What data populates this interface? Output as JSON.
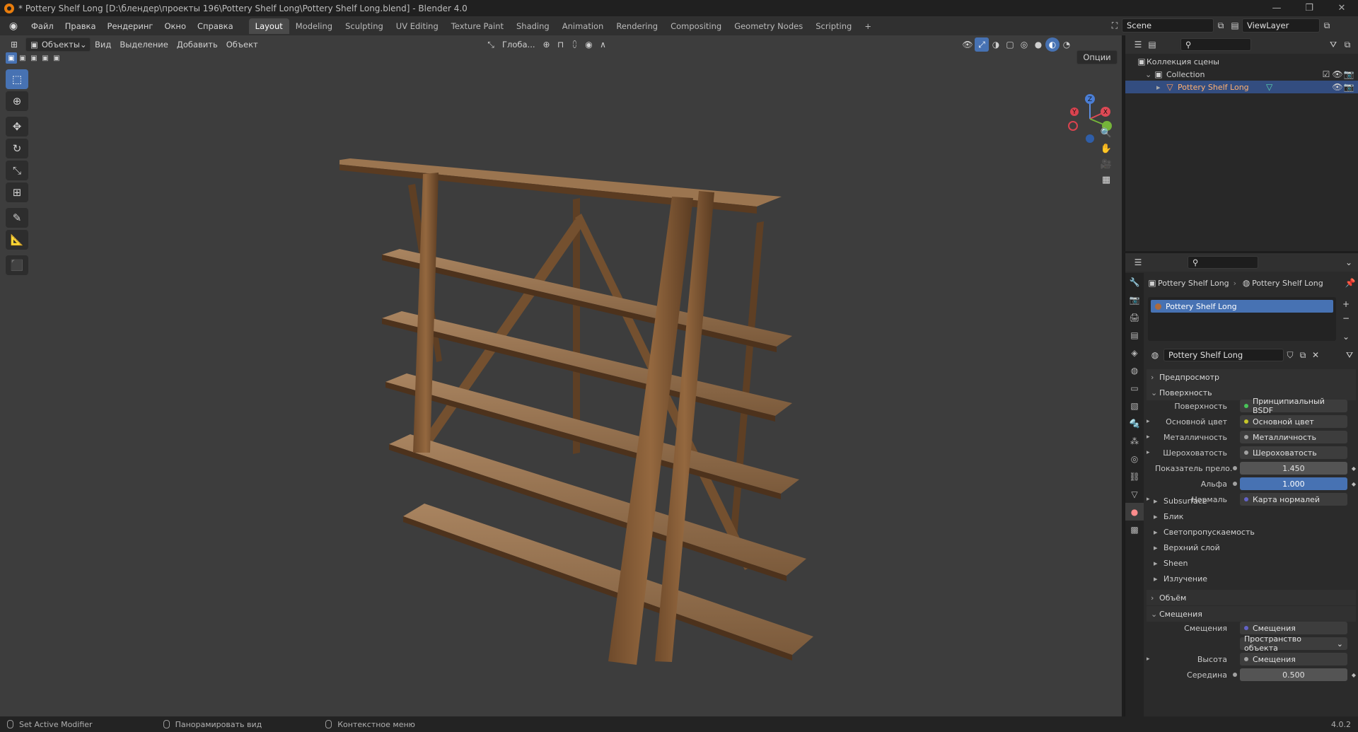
{
  "window": {
    "title": "* Pottery Shelf Long [D:\\блендер\\проекты 196\\Pottery Shelf Long\\Pottery Shelf Long.blend] - Blender 4.0"
  },
  "menu": [
    "Файл",
    "Правка",
    "Рендеринг",
    "Окно",
    "Справка"
  ],
  "workspaces": [
    {
      "label": "Layout",
      "active": true
    },
    {
      "label": "Modeling"
    },
    {
      "label": "Sculpting"
    },
    {
      "label": "UV Editing"
    },
    {
      "label": "Texture Paint"
    },
    {
      "label": "Shading"
    },
    {
      "label": "Animation"
    },
    {
      "label": "Rendering"
    },
    {
      "label": "Compositing"
    },
    {
      "label": "Geometry Nodes"
    },
    {
      "label": "Scripting"
    }
  ],
  "scene": {
    "name": "Scene",
    "view_layer": "ViewLayer"
  },
  "viewport": {
    "mode": "Объекты",
    "menus": [
      "Вид",
      "Выделение",
      "Добавить",
      "Объект"
    ],
    "orientation": "Глоба...",
    "options_label": "Опции",
    "gizmo": {
      "x": "X",
      "y": "Y",
      "z": "Z"
    }
  },
  "outliner": {
    "scene_collection": "Коллекция сцены",
    "collection": "Collection",
    "object": "Pottery Shelf Long"
  },
  "properties": {
    "breadcrumb_object": "Pottery Shelf Long",
    "breadcrumb_material": "Pottery Shelf Long",
    "slot": "Pottery Shelf Long",
    "material_name": "Pottery Shelf Long",
    "panels": {
      "preview": "Предпросмотр",
      "surface": "Поверхность",
      "volume": "Объём",
      "displacement": "Смещения"
    },
    "surface_rows": [
      {
        "label": "Поверхность",
        "value": "Принципиальный BSDF",
        "dot": "#49c459"
      },
      {
        "label": "Основной цвет",
        "value": "Основной цвет",
        "dot": "#c7c729",
        "arrow": true
      },
      {
        "label": "Металличность",
        "value": "Металличность",
        "dot": "#a1a1a1",
        "arrow": true
      },
      {
        "label": "Шероховатость",
        "value": "Шероховатость",
        "dot": "#a1a1a1",
        "arrow": true
      },
      {
        "label": "Показатель прело...",
        "value": "1.450",
        "dot": "#a1a1a1",
        "numeric": true
      },
      {
        "label": "Альфа",
        "value": "1.000",
        "dot": "#a1a1a1",
        "numeric": true,
        "highlight": true
      },
      {
        "label": "Нормаль",
        "value": "Карта нормалей",
        "dot": "#6363c7",
        "arrow": true
      }
    ],
    "subpanels": [
      "Subsurface",
      "Блик",
      "Светопропускаемость",
      "Верхний слой",
      "Sheen",
      "Излучение"
    ],
    "displacement_rows": [
      {
        "label": "Смещения",
        "value": "Смещения",
        "dot": "#6363c7"
      },
      {
        "label": "",
        "value": "Пространство объекта",
        "dropdown": true
      },
      {
        "label": "Высота",
        "value": "Смещения",
        "dot": "#a1a1a1",
        "arrow": true
      },
      {
        "label": "Середина",
        "value": "0.500",
        "dot": "#a1a1a1",
        "numeric": true
      }
    ]
  },
  "status": {
    "left": "Set Active Modifier",
    "middle": "Панорамировать вид",
    "right": "Контекстное меню",
    "version": "4.0.2"
  }
}
